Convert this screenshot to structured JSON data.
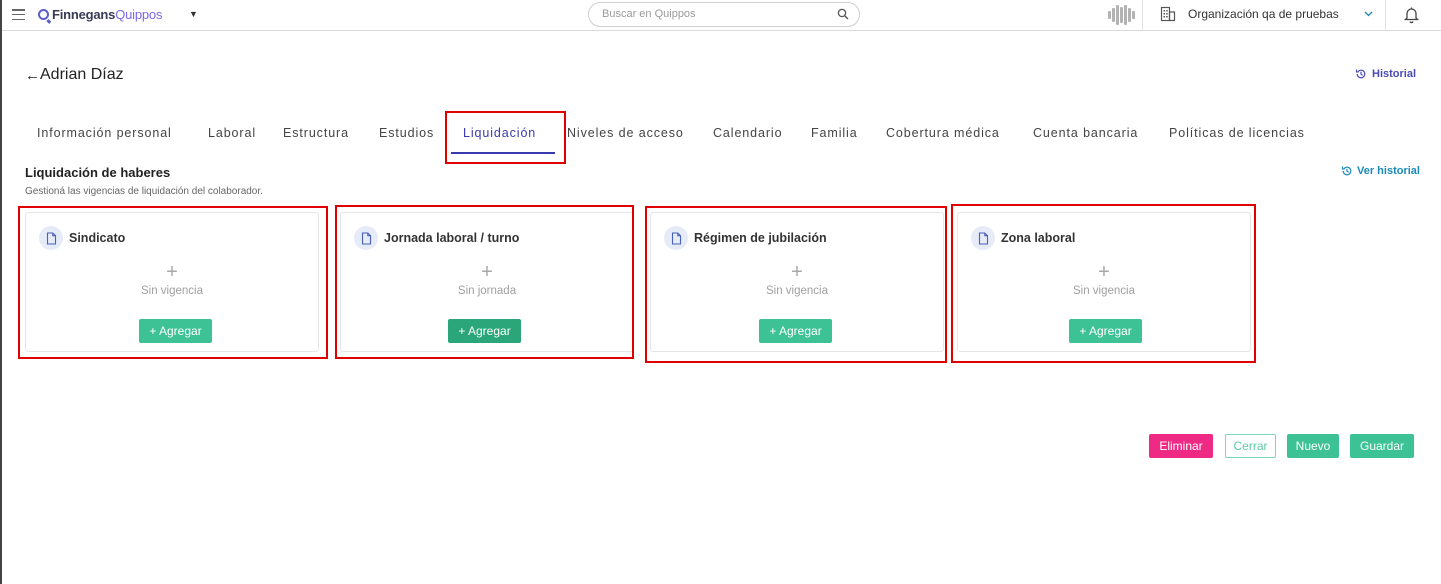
{
  "app": {
    "brand_primary": "Finnegans",
    "brand_secondary": "Quippos",
    "search_placeholder": "Buscar en Quippos",
    "organization": "Organización qa de pruebas"
  },
  "header": {
    "back_arrow": "←",
    "title": "Adrian Díaz",
    "historial": "Historial"
  },
  "tabs": [
    {
      "label": "Información personal"
    },
    {
      "label": "Laboral"
    },
    {
      "label": "Estructura"
    },
    {
      "label": "Estudios"
    },
    {
      "label": "Liquidación",
      "active": true
    },
    {
      "label": "Niveles de acceso"
    },
    {
      "label": "Calendario"
    },
    {
      "label": "Familia"
    },
    {
      "label": "Cobertura médica"
    },
    {
      "label": "Cuenta bancaria"
    },
    {
      "label": "Políticas de licencias"
    }
  ],
  "section": {
    "title": "Liquidación de haberes",
    "subtitle": "Gestioná las vigencias de liquidación del colaborador.",
    "ver_historial": "Ver historial"
  },
  "cards": [
    {
      "title": "Sindicato",
      "plus": "+",
      "empty": "Sin vigencia",
      "add": "+ Agregar"
    },
    {
      "title": "Jornada laboral / turno",
      "plus": "+",
      "empty": "Sin jornada",
      "add": "+ Agregar"
    },
    {
      "title": "Régimen de jubilación",
      "plus": "+",
      "empty": "Sin vigencia",
      "add": "+ Agregar"
    },
    {
      "title": "Zona laboral",
      "plus": "+",
      "empty": "Sin vigencia",
      "add": "+ Agregar"
    }
  ],
  "actions": {
    "eliminar": "Eliminar",
    "cerrar": "Cerrar",
    "nuevo": "Nuevo",
    "guardar": "Guardar"
  },
  "colors": {
    "accent": "#3a3ab0",
    "success": "#3cc294",
    "danger": "#ee2a85",
    "highlight": "#e00000"
  },
  "icons": {
    "menu": "hamburger-menu-icon",
    "search": "search-icon",
    "organization": "building-icon",
    "notifications": "bell-icon",
    "history": "history-icon",
    "document": "document-icon"
  }
}
